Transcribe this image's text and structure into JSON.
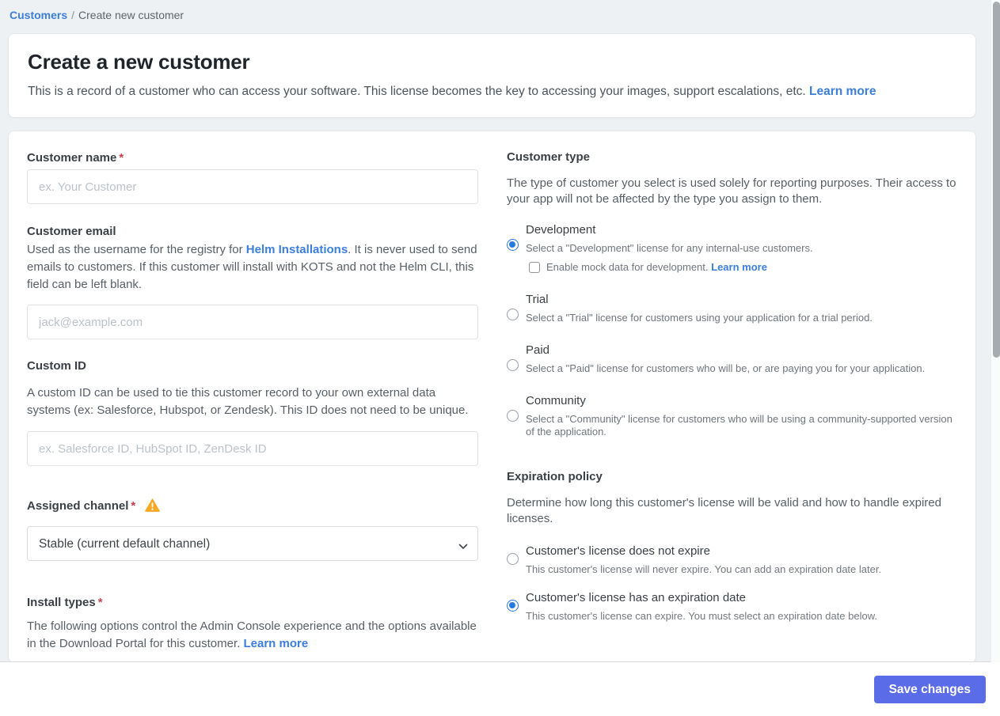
{
  "breadcrumb": {
    "link": "Customers",
    "separator": "/",
    "current": "Create new customer"
  },
  "header": {
    "title": "Create a new customer",
    "description": "This is a record of a customer who can access your software. This license becomes the key to accessing your images, support escalations, etc.",
    "learn_more": "Learn more"
  },
  "form": {
    "customer_name": {
      "label": "Customer name",
      "required": "*",
      "placeholder": "ex. Your Customer"
    },
    "customer_email": {
      "label": "Customer email",
      "description_before": "Used as the username for the registry for ",
      "description_link": "Helm Installations",
      "description_after": ". It is never used to send emails to customers. If this customer will install with KOTS and not the Helm CLI, this field can be left blank.",
      "placeholder": "jack@example.com"
    },
    "custom_id": {
      "label": "Custom ID",
      "description": "A custom ID can be used to tie this customer record to your own external data systems (ex: Salesforce, Hubspot, or Zendesk). This ID does not need to be unique.",
      "placeholder": "ex. Salesforce ID, HubSpot ID, ZenDesk ID"
    },
    "assigned_channel": {
      "label": "Assigned channel",
      "required": "*",
      "selected_option": "Stable (current default channel)"
    },
    "install_types": {
      "label": "Install types",
      "required": "*",
      "description": "The following options control the Admin Console experience and the options available in the Download Portal for this customer.",
      "learn_more": "Learn more"
    }
  },
  "customer_type": {
    "heading": "Customer type",
    "description": "The type of customer you select is used solely for reporting purposes. Their access to your app will not be affected by the type you assign to them.",
    "options": [
      {
        "label": "Development",
        "description": "Select a \"Development\" license for any internal-use customers.",
        "selected": true,
        "checkbox_label": "Enable mock data for development.",
        "checkbox_learn_more": "Learn more"
      },
      {
        "label": "Trial",
        "description": "Select a \"Trial\" license for customers using your application for a trial period.",
        "selected": false
      },
      {
        "label": "Paid",
        "description": "Select a \"Paid\" license for customers who will be, or are paying you for your application.",
        "selected": false
      },
      {
        "label": "Community",
        "description": "Select a \"Community\" license for customers who will be using a community-supported version of the application.",
        "selected": false
      }
    ]
  },
  "expiration_policy": {
    "heading": "Expiration policy",
    "description": "Determine how long this customer's license will be valid and how to handle expired licenses.",
    "options": [
      {
        "label": "Customer's license does not expire",
        "description": "This customer's license will never expire. You can add an expiration date later.",
        "selected": false
      },
      {
        "label": "Customer's license has an expiration date",
        "description": "This customer's license can expire. You must select an expiration date below.",
        "selected": true
      }
    ]
  },
  "footer": {
    "save_button": "Save changes"
  },
  "colors": {
    "link_blue": "#3b7fdb",
    "radio_selected_blue": "#2879e2",
    "save_button_indigo": "#5b6ce8",
    "warning_orange": "#f9a825",
    "required_red": "#cc3f4d",
    "page_background": "#eef1f3"
  }
}
